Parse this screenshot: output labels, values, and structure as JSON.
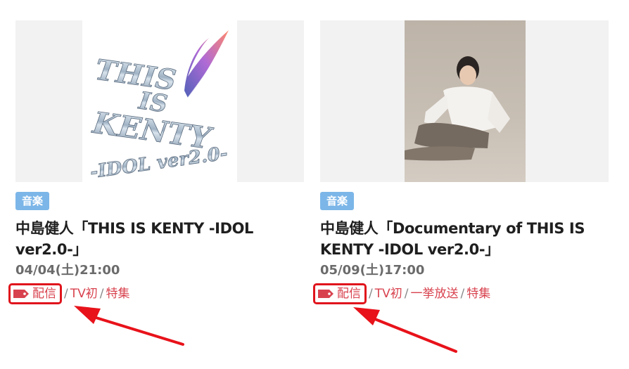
{
  "cards": [
    {
      "genre": "音楽",
      "title": "中島健人「THIS IS KENTY -IDOL ver2.0-」",
      "datetime": "04/04(土)21:00",
      "tags": [
        "配信",
        "TV初",
        "特集"
      ],
      "image": {
        "logo_lines": [
          "THIS",
          "IS",
          "KENTY",
          "-IDOL ver2.0-"
        ]
      }
    },
    {
      "genre": "音楽",
      "title": "中島健人「Documentary of THIS IS KENTY -IDOL ver2.0-」",
      "datetime": "05/09(土)17:00",
      "tags": [
        "配信",
        "TV初",
        "一挙放送",
        "特集"
      ],
      "image": {}
    }
  ],
  "separator": "/",
  "colors": {
    "badge_bg": "#7cb6e8",
    "tag_link": "#d8424e",
    "highlight_border": "#e0141c",
    "arrow": "#e8121a"
  },
  "icons": {
    "stream_tag": "price-tag-icon",
    "annotation": "red-arrow-icon"
  }
}
